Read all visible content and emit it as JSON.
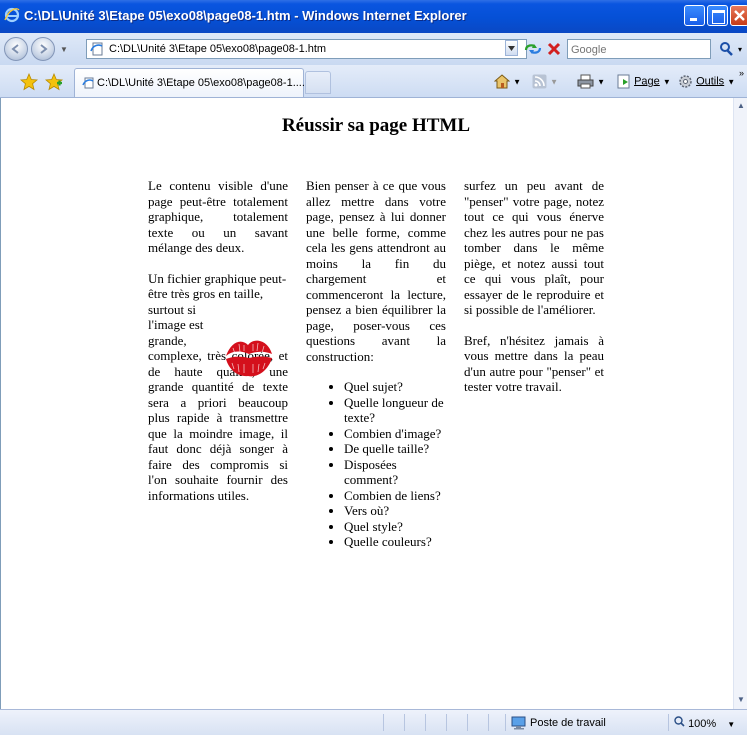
{
  "window": {
    "title": "C:\\DL\\Unité 3\\Etape 05\\exo08\\page08-1.htm - Windows Internet Explorer"
  },
  "addressbar": {
    "url": "C:\\DL\\Unité 3\\Etape 05\\exo08\\page08-1.htm",
    "search_placeholder": "Google"
  },
  "tab": {
    "label": "C:\\DL\\Unité 3\\Etape 05\\exo08\\page08-1...."
  },
  "commands": {
    "page": "Page",
    "tools": "Outils"
  },
  "page": {
    "title": "Réussir sa page HTML",
    "col1": {
      "p1": "Le contenu visible d'une page peut-être totalement graphique, totalement texte ou un savant mélange des deux.",
      "p2": "Un fichier graphique peut-être très gros en taille,",
      "p2_line2": "surtout si",
      "p2_line3": "l'image est",
      "p2_line4": "grande,",
      "p2_rest": "complexe, très colorée, et de haute qualité, une grande quantité de texte sera a priori beaucoup plus rapide à transmettre que la moindre image, il faut donc déjà songer à faire des compromis si l'on souhaite fournir des informations utiles."
    },
    "col2": {
      "p1": "Bien penser à ce que vous allez mettre dans votre page, pensez à lui donner une belle forme, comme cela les gens attendront au moins la fin du chargement et commenceront la lecture, pensez a bien équilibrer la page, poser-vous ces questions avant la construction:",
      "questions": [
        "Quel sujet?",
        "Quelle longueur de texte?",
        "Combien d'image?",
        "De quelle taille?",
        "Disposées comment?",
        "Combien de liens?",
        "Vers où?",
        "Quel style?",
        "Quelle couleurs?"
      ]
    },
    "col3": {
      "p1": "surfez un peu avant de \"penser\" votre page, notez tout ce qui vous énerve chez les autres pour ne pas tomber dans le même piège, et notez aussi tout ce qui vous plaît, pour essayer de le reproduire et si possible de l'améliorer.",
      "p2": "Bref, n'hésitez jamais à vous mettre dans la peau d'un autre pour \"penser\" et tester votre travail."
    }
  },
  "statusbar": {
    "zone": "Poste de travail",
    "zoom": "100%"
  },
  "colors": {
    "titlebar": "#0550d6",
    "kiss": "#d4101c"
  }
}
